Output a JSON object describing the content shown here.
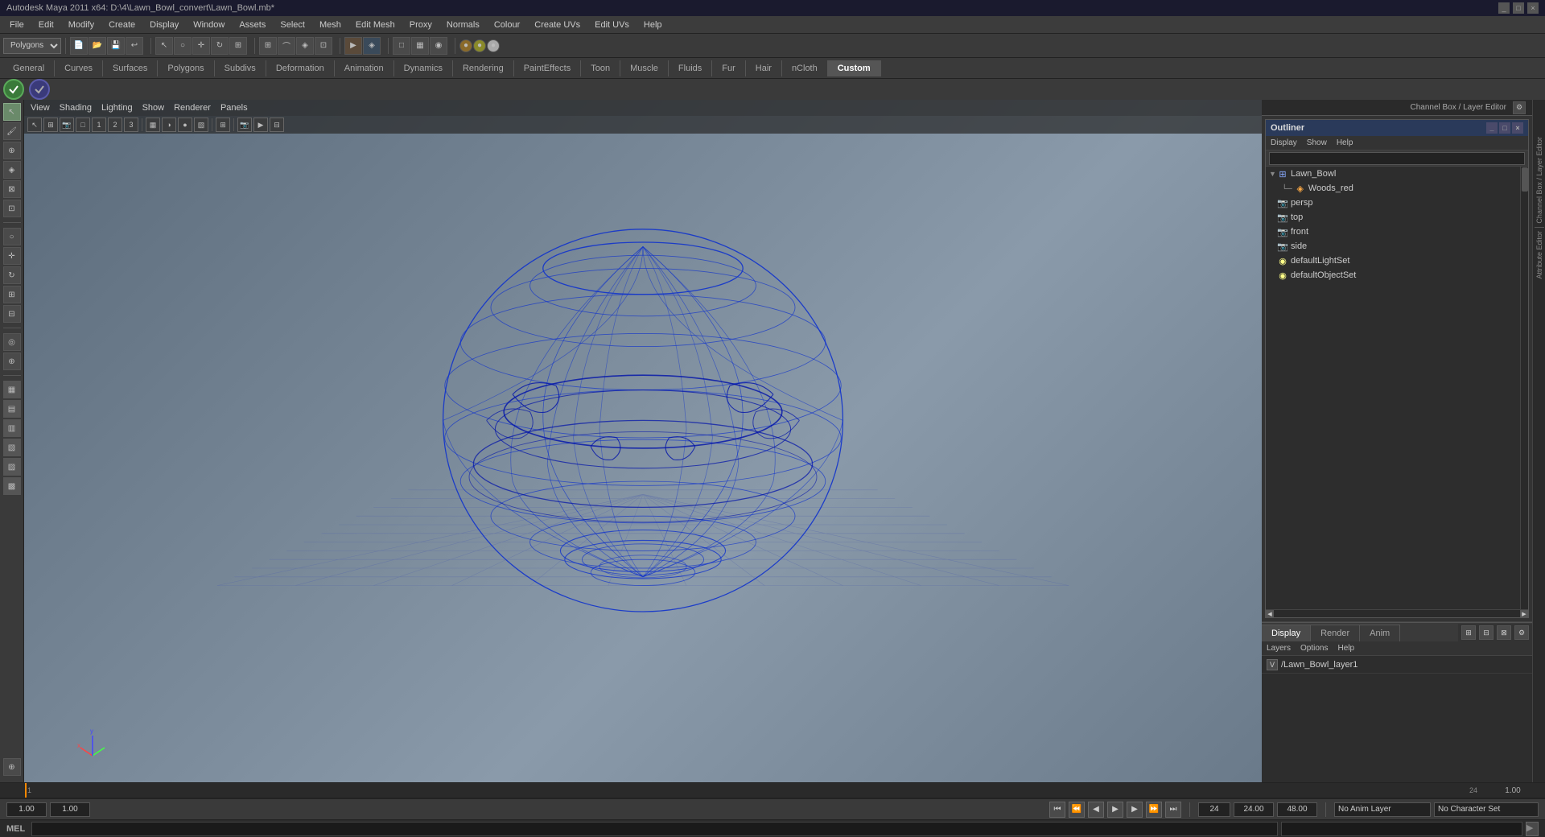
{
  "app": {
    "title": "Autodesk Maya 2011 x64: D:\\4\\Lawn_Bowl_convert\\Lawn_Bowl.mb*",
    "window_controls": [
      "_",
      "□",
      "×"
    ]
  },
  "menu_bar": {
    "items": [
      "File",
      "Edit",
      "Modify",
      "Create",
      "Display",
      "Window",
      "Assets",
      "Select",
      "Mesh",
      "Edit Mesh",
      "Proxy",
      "Normals",
      "Colour",
      "Create UVs",
      "Edit UVs",
      "Help"
    ]
  },
  "toolbar": {
    "mode_dropdown": "Polygons"
  },
  "tab_bar": {
    "tabs": [
      "General",
      "Curves",
      "Surfaces",
      "Polygons",
      "Subdivs",
      "Deformation",
      "Animation",
      "Dynamics",
      "Rendering",
      "PaintEffects",
      "Toon",
      "Muscle",
      "Fluids",
      "Fur",
      "Hair",
      "nCloth",
      "Custom"
    ]
  },
  "viewport": {
    "menu_items": [
      "View",
      "Shading",
      "Lighting",
      "Show",
      "Renderer",
      "Panels"
    ],
    "label": "",
    "bowl_color": "#0000cc",
    "grid_color": "#555566",
    "background_top": "#6a7a8a",
    "background_bottom": "#8a9aaa"
  },
  "outliner": {
    "title": "Outliner",
    "menu": [
      "Display",
      "Show",
      "Help"
    ],
    "items": [
      {
        "name": "Lawn_Bowl",
        "indent": 0,
        "icon": "mesh",
        "expanded": true
      },
      {
        "name": "Woods_red",
        "indent": 1,
        "icon": "material"
      },
      {
        "name": "persp",
        "indent": 0,
        "icon": "camera"
      },
      {
        "name": "top",
        "indent": 0,
        "icon": "camera"
      },
      {
        "name": "front",
        "indent": 0,
        "icon": "camera"
      },
      {
        "name": "side",
        "indent": 0,
        "icon": "camera"
      },
      {
        "name": "defaultLightSet",
        "indent": 0,
        "icon": "set"
      },
      {
        "name": "defaultObjectSet",
        "indent": 0,
        "icon": "set"
      }
    ]
  },
  "channel_box": {
    "label": "Channel Box / Layer Editor"
  },
  "lower_panel": {
    "tabs": [
      "Display",
      "Render",
      "Anim"
    ],
    "active_tab": "Display",
    "menu_items": [
      "Layers",
      "Options",
      "Help"
    ],
    "layer": {
      "vis": "V",
      "name": "/Lawn_Bowl_layer1"
    }
  },
  "timeline": {
    "start": 1,
    "end": 24,
    "current": 1,
    "range_start": "1.00",
    "range_end": "24.00",
    "total_frames": "48.00",
    "ticks": [
      "1",
      "",
      "",
      "",
      "",
      "",
      "",
      "",
      "",
      "",
      "",
      "",
      "",
      "",
      "",
      "",
      "",
      "",
      "",
      "",
      "",
      "",
      "",
      "",
      "",
      "",
      "",
      "",
      "",
      "",
      "",
      "",
      "",
      "",
      "",
      "",
      "",
      "",
      "",
      "",
      "",
      "",
      "",
      "",
      "",
      "",
      "",
      "",
      "",
      "",
      "",
      "",
      "",
      "",
      "",
      "",
      "",
      "",
      "",
      "",
      "",
      "",
      "",
      "",
      "",
      "",
      "",
      "",
      "",
      "",
      "",
      "",
      "",
      "",
      "",
      "",
      "",
      "",
      "",
      "",
      "",
      "",
      "",
      "",
      "",
      "",
      "",
      "",
      "",
      "",
      "",
      "",
      "",
      "",
      "",
      "",
      "",
      "",
      "",
      "",
      "",
      "",
      "",
      "",
      "",
      "",
      "",
      "",
      "",
      "",
      "24"
    ]
  },
  "playback": {
    "start_field": "1.00",
    "current_field": "1.00",
    "keyframe": "1",
    "end_field": "24",
    "total_field": "48.00",
    "anim_layer": "No Anim Layer",
    "char_set": "No Character Set",
    "buttons": [
      "<<",
      "<|",
      "<",
      "▶",
      ">",
      "|>",
      ">>"
    ]
  },
  "status_bar": {
    "mel_label": "MEL",
    "command_placeholder": "",
    "help_text": ""
  },
  "attribute_strips": {
    "right1": "Channel Box / Layer Editor",
    "right2": "Attribute Editor"
  }
}
